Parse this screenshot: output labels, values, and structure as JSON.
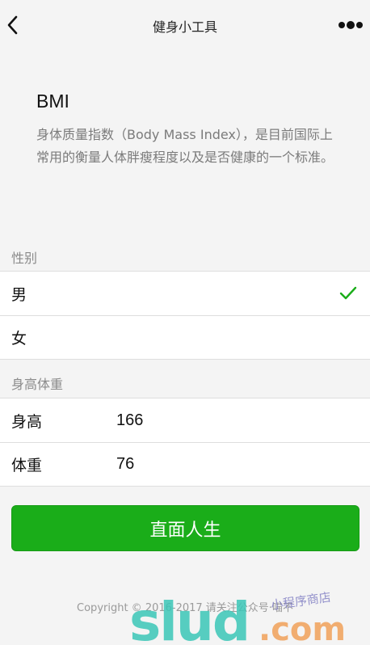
{
  "nav": {
    "title": "健身小工具"
  },
  "intro": {
    "title": "BMI",
    "description": "身体质量指数（Body Mass Index），是目前国际上常用的衡量人体胖瘦程度以及是否健康的一个标准。"
  },
  "gender": {
    "section_label": "性别",
    "options": [
      {
        "label": "男",
        "selected": true
      },
      {
        "label": "女",
        "selected": false
      }
    ]
  },
  "body": {
    "section_label": "身高体重",
    "height_label": "身高",
    "height_value": "166",
    "weight_label": "体重",
    "weight_value": "76"
  },
  "action": {
    "label": "直面人生"
  },
  "footer": {
    "copyright": "Copyright © 2016-2017 请关注公众号·喵不"
  },
  "watermark": {
    "text": "slud.com",
    "sub_text": "小程序商店"
  },
  "colors": {
    "primary": "#1aad19",
    "check": "#1aad19"
  },
  "icons": {
    "back": "chevron-left-icon",
    "more": "more-dots-icon",
    "check": "checkmark-icon"
  }
}
